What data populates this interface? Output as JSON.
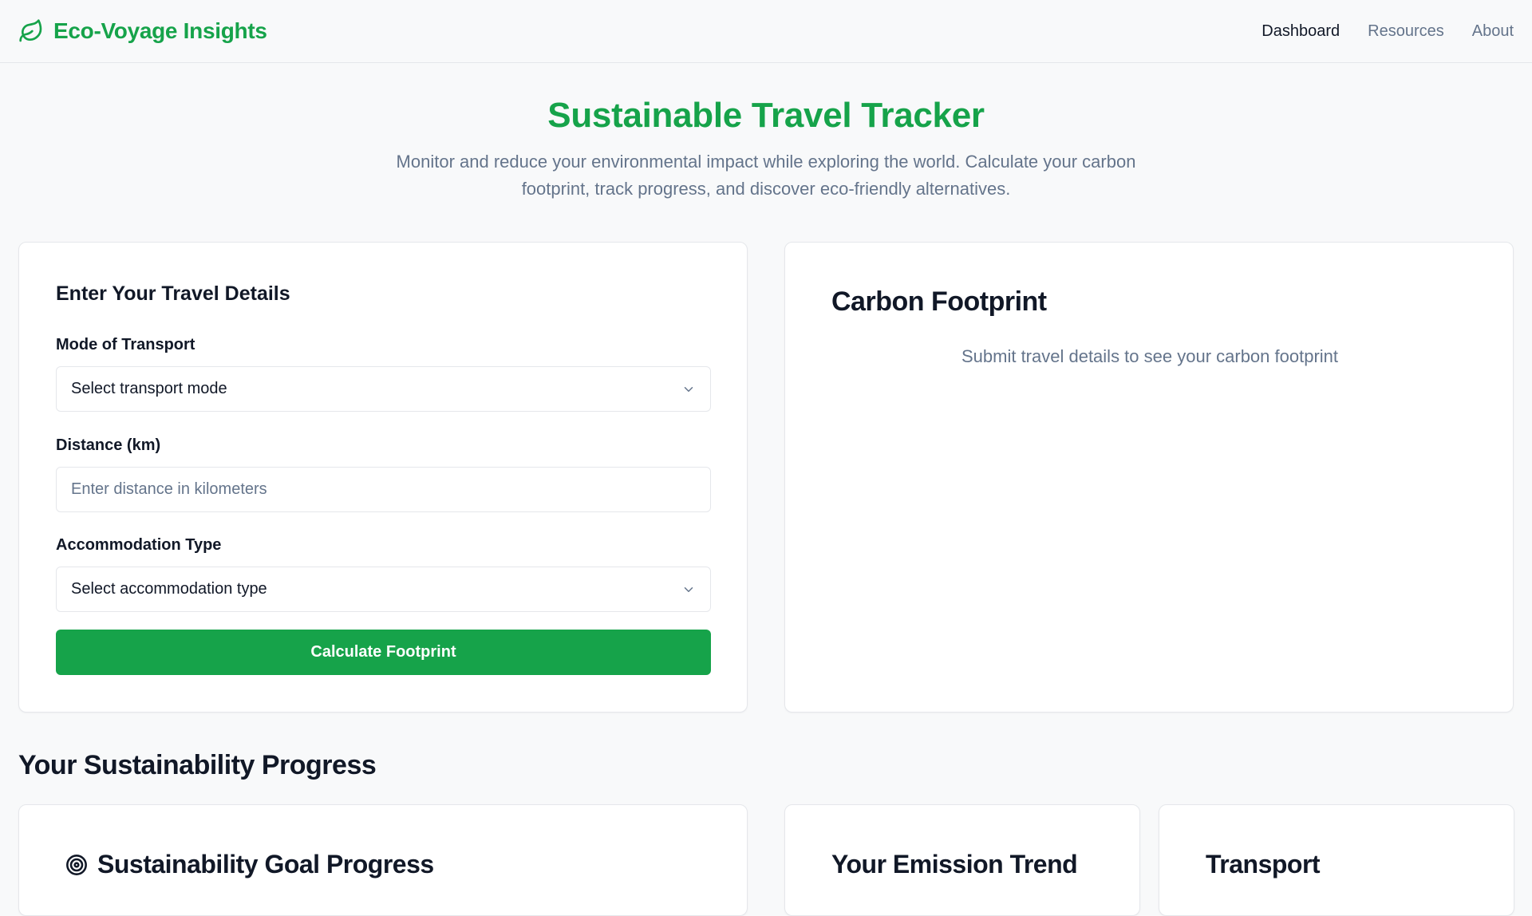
{
  "header": {
    "brand": "Eco-Voyage Insights",
    "nav": [
      {
        "label": "Dashboard",
        "active": true
      },
      {
        "label": "Resources",
        "active": false
      },
      {
        "label": "About",
        "active": false
      }
    ]
  },
  "hero": {
    "title": "Sustainable Travel Tracker",
    "subtitle": "Monitor and reduce your environmental impact while exploring the world. Calculate your carbon footprint, track progress, and discover eco-friendly alternatives."
  },
  "form": {
    "title": "Enter Your Travel Details",
    "transport_label": "Mode of Transport",
    "transport_value": "Select transport mode",
    "distance_label": "Distance (km)",
    "distance_placeholder": "Enter distance in kilometers",
    "accommodation_label": "Accommodation Type",
    "accommodation_value": "Select accommodation type",
    "submit_label": "Calculate Footprint"
  },
  "result": {
    "title": "Carbon Footprint",
    "message": "Submit travel details to see your carbon footprint"
  },
  "progress": {
    "section_title": "Your Sustainability Progress",
    "goal_title": "Sustainability Goal Progress",
    "trend_title": "Your Emission Trend",
    "transport_title": "Transport"
  },
  "colors": {
    "brand_green": "#16a34a",
    "muted_text": "#64748b",
    "border": "#e5e7eb"
  }
}
